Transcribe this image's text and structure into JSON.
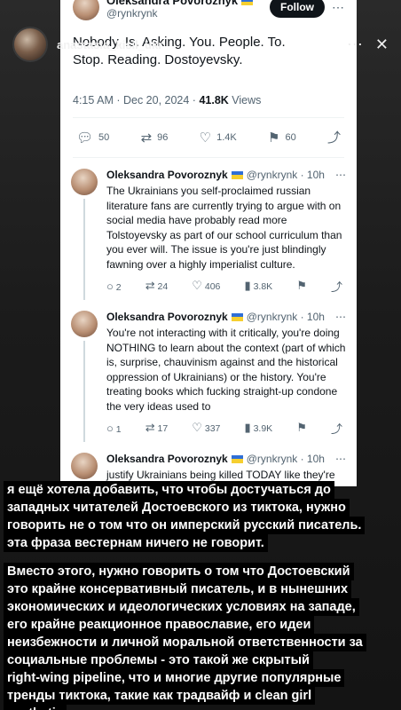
{
  "story": {
    "username": "anastasia_kisil_ukr",
    "close_icon": "close-icon",
    "more_icon": "more-icon"
  },
  "main_tweet": {
    "name": "Oleksandra Povoroznyk",
    "handle": "@rynkrynk",
    "follow_label": "Follow",
    "text": "Nobody. Is. Asking. You. People. To. Stop. Reading. Dostoyevsky.",
    "time": "4:15 AM · Dec 20, 2024 · ",
    "views": "41.8K",
    "views_suffix": " Views",
    "actions": {
      "replies": "50",
      "retweets": "96",
      "likes": "1.4K",
      "bookmarks": "60"
    }
  },
  "replies": [
    {
      "name": "Oleksandra Povoroznyk",
      "handle": "@rynkrynk · 10h",
      "text": "The Ukrainians you self-proclaimed russian literature fans are currently trying to argue with on social media have probably read more Tolstoyevsky as part of our school curriculum than you ever will. The issue is you're just blindingly fawning over a highly imperialist culture.",
      "replies": "2",
      "retweets": "24",
      "likes": "406",
      "views": "3.8K"
    },
    {
      "name": "Oleksandra Povoroznyk",
      "handle": "@rynkrynk · 10h",
      "text": "You're not interacting with it critically, you're doing NOTHING to learn about the context (part of which is, surprise, chauvinism against and the historical oppression of Ukrainians) or the history. You're treating books which fucking straight-up condone the very ideas used to",
      "replies": "1",
      "retweets": "17",
      "likes": "337",
      "views": "3.9K"
    },
    {
      "name": "Oleksandra Povoroznyk",
      "handle": "@rynkrynk · 10h",
      "text": "justify Ukrainians being killed TODAY like they're the latest hot accessory meant to tell the world how smart and educated you are. You're all fucking posers."
    }
  ],
  "overlay": {
    "paragraph1": [
      "я ещё хотела добавить, что чтобы достучаться до",
      "западных читателей Достоевского из тиктока, нужно",
      "говорить не о том что он имперский русский писатель.",
      "эта фраза вестернам ничего не говорит."
    ],
    "paragraph2": [
      "Вместо этого, нужно говорить о том что Достоевский",
      "это крайне консервативный писатель, и в нынешних",
      "экономических и идеологических условиях на западе,",
      "его крайне реакционное православие, его идеи",
      "неизбежности и личной моральной ответственности за",
      "социальные проблемы - это такой же скрытый",
      "right-wing pipeline, что и многие другие популярные",
      "тренды тиктока, такие как традвайф и clean girl",
      "aesthetic"
    ]
  }
}
